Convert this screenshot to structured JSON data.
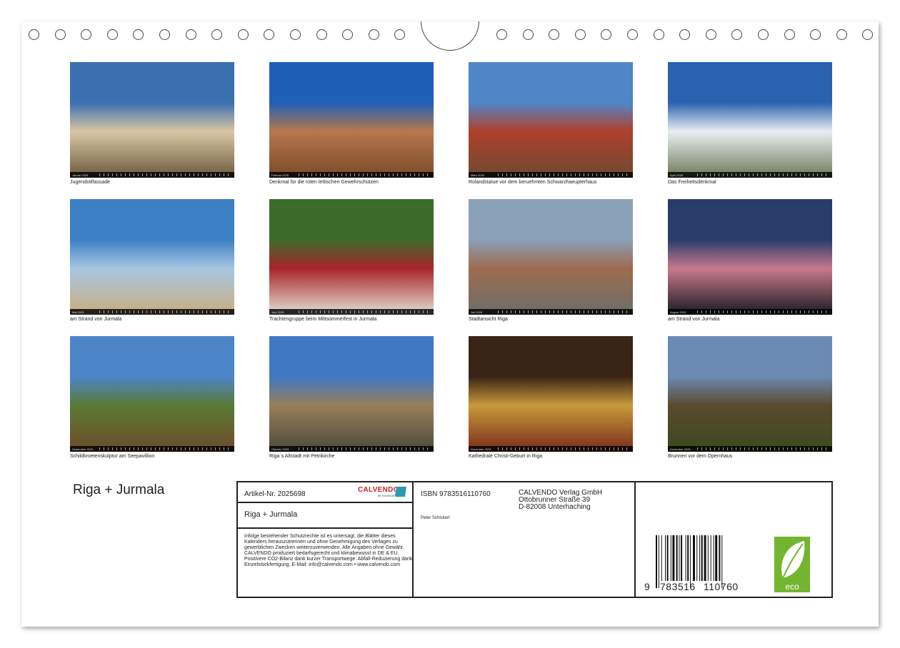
{
  "cover": {
    "title": "Riga + Jurmala"
  },
  "photos": [
    {
      "month": "Januar 2025",
      "caption": "Jugendstilfassade",
      "colors": [
        "#3a6fb0",
        "#d9c7a4",
        "#6b5a3e"
      ],
      "icon": "art-nouveau-facade"
    },
    {
      "month": "Februar 2025",
      "caption": "Denkmal für die roten lettischen Gewehrschützen",
      "colors": [
        "#1f5fb8",
        "#b9774c",
        "#7a4a2c"
      ],
      "icon": "red-riflemen-monument"
    },
    {
      "month": "März 2025",
      "caption": "Rolandstatue vor dem beruehmten Schwarzhaeupterhaus",
      "colors": [
        "#4f86c8",
        "#b0402a",
        "#6d4a33"
      ],
      "icon": "house-of-blackheads"
    },
    {
      "month": "April 2025",
      "caption": "Das Freiheitsdenkmal",
      "colors": [
        "#2a62b0",
        "#e9edf2",
        "#6d7a55"
      ],
      "icon": "freedom-monument"
    },
    {
      "month": "Mai 2025",
      "caption": "am Strand von Jurmala",
      "colors": [
        "#3c7fc4",
        "#a8c6e2",
        "#c9ad7e"
      ],
      "icon": "beach-seagulls"
    },
    {
      "month": "Juni 2025",
      "caption": "Trachtengruppe beim Mittsommerfest in Jurmala",
      "colors": [
        "#3d6b2a",
        "#a8242b",
        "#e6e0d4"
      ],
      "icon": "folk-costume-group"
    },
    {
      "month": "Juli 2025",
      "caption": "Stadtansicht Riga",
      "colors": [
        "#8aa0b8",
        "#9d6b4e",
        "#6b6f6a"
      ],
      "icon": "city-view"
    },
    {
      "month": "August 2025",
      "caption": "am Strand von Jurmala",
      "colors": [
        "#2a3c6a",
        "#c77a8c",
        "#1a1a22"
      ],
      "icon": "beach-sunset"
    },
    {
      "month": "September 2025",
      "caption": "Schildkroetenskulptur am Seepavillion",
      "colors": [
        "#4d85c9",
        "#5a7a34",
        "#6e4a2a"
      ],
      "icon": "turtle-sculpture"
    },
    {
      "month": "Oktober 2025",
      "caption": "Riga`s Altstadt mit Petrikirche",
      "colors": [
        "#3f78c3",
        "#9a7e5a",
        "#4a4a3a"
      ],
      "icon": "old-town-church"
    },
    {
      "month": "November 2025",
      "caption": "Kathedrale Christi-Geburt in Riga",
      "colors": [
        "#3a2416",
        "#c89a3a",
        "#7a2a1a"
      ],
      "icon": "cathedral-iconostasis"
    },
    {
      "month": "Dezember 2025",
      "caption": "Brunnen vor dem Opernhaus",
      "colors": [
        "#6b8ab2",
        "#5a4a2e",
        "#3a4a1e"
      ],
      "icon": "opera-fountain"
    }
  ],
  "info": {
    "article_no": "Artikel-Nr. 2025698",
    "calvendo_logo": "CALVENDO",
    "calvendo_tagline": "Ihr Kunstverlag",
    "title": "Riga + Jurmala",
    "legal": "Infolge bestehender Schutzrechte ist es untersagt, die Blätter dieses Kalenders herauszutrennen und ohne Genehmigung des Verlages zu gewerblichen Zwecken weiterzuverwenden. Alle Angaben ohne Gewähr. CALVENDO produziert bedarfsgerecht und klimabewusst in DE & EU. Positivere CO2-Bilanz dank kurzer Transportwege. Abfall-Reduzierung dank Einzelstückfertigung. E-Mail: info@calvendo.com • www.calvendo.com",
    "isbn": "ISBN 9783516110760",
    "publisher_line1": "CALVENDO Verlag GmbH",
    "publisher_line2": "Ottobrunner Straße 39",
    "publisher_line3": "D-82008 Unterhaching",
    "author": "Peter Schickert",
    "barcode_digits_1": "9",
    "barcode_digits_2": "783516",
    "barcode_digits_3": "110760",
    "eco_label": "eco",
    "eco_color": "#74b530"
  }
}
